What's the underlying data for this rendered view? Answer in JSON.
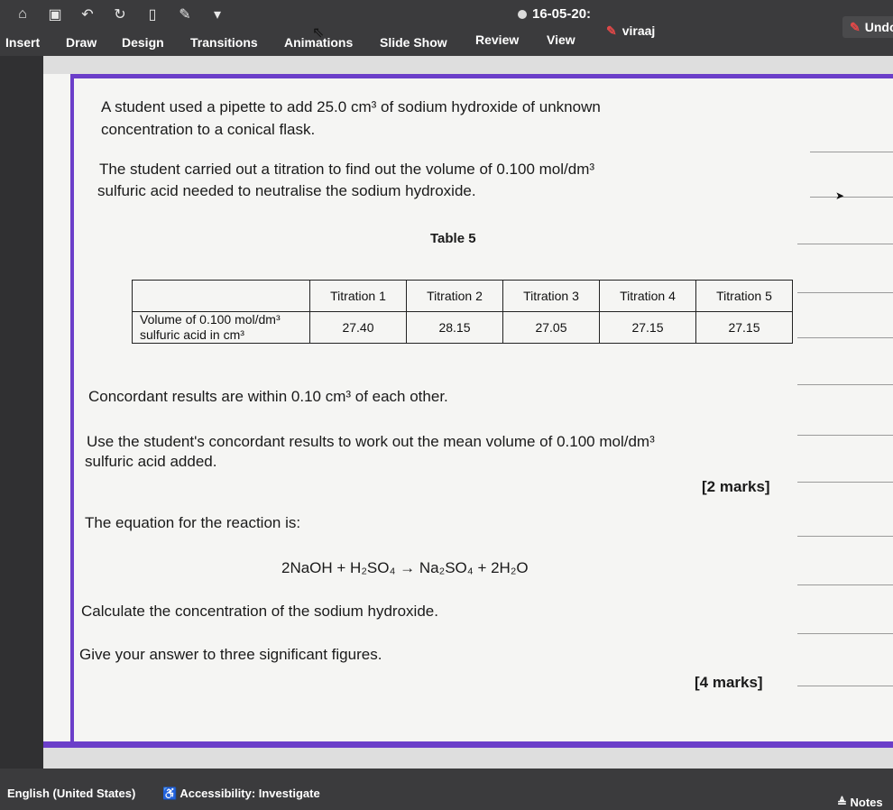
{
  "titlebar": {
    "quick_access": [
      "home-icon",
      "save-icon",
      "undo-icon",
      "redo-icon",
      "new-slide-icon",
      "draw-icon",
      "dropdown-icon"
    ],
    "file_title": "16-05-20:",
    "user": "viraaj",
    "undo_label": "Undo"
  },
  "menu": {
    "tabs": [
      "Insert",
      "Draw",
      "Design",
      "Transitions",
      "Animations",
      "Slide Show",
      "Review",
      "View"
    ]
  },
  "slide": {
    "intro_line1": "A student used a pipette to add 25.0 cm³ of sodium hydroxide of unknown",
    "intro_line2": "concentration to a conical flask.",
    "titration_line1": "The student carried out a titration to find out the volume of 0.100 mol/dm³",
    "titration_line2": "sulfuric acid needed to neutralise the sodium hydroxide.",
    "table_caption": "Table 5",
    "table": {
      "headers": [
        "",
        "Titration 1",
        "Titration 2",
        "Titration 3",
        "Titration 4",
        "Titration 5"
      ],
      "row_label_line1": "Volume of 0.100 mol/dm³",
      "row_label_line2": "sulfuric acid in cm³",
      "values": [
        "27.40",
        "28.15",
        "27.05",
        "27.15",
        "27.15"
      ]
    },
    "concordant_note": "Concordant results are within 0.10 cm³ of each other.",
    "q1_line1": "Use the student's concordant results to work out the mean volume of 0.100 mol/dm³",
    "q1_line2": "sulfuric acid added.",
    "q1_marks": "[2 marks]",
    "equation_intro": "The equation for the reaction is:",
    "equation": "2NaOH + H₂SO₄ → Na₂SO₄ + 2H₂O",
    "q2_line1": "Calculate the concentration of the sodium hydroxide.",
    "q2_line2": "Give your answer to three significant figures.",
    "q2_marks": "[4 marks]"
  },
  "statusbar": {
    "language": "English (United States)",
    "accessibility": "Accessibility: Investigate",
    "notes": "≜ Notes"
  },
  "colors": {
    "chrome": "#3b3b3d",
    "slide_border": "#6b3ec9",
    "slide_bg": "#f5f5f3",
    "pen_accent": "#e04848"
  }
}
